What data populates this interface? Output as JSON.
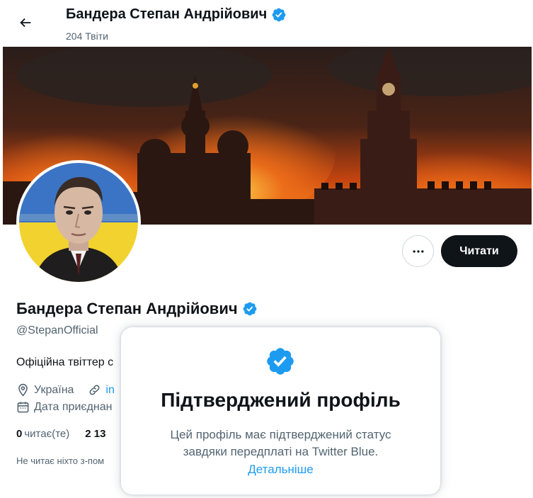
{
  "header": {
    "name": "Бандера Степан Андрійович",
    "tweets_count": "204 Твіти"
  },
  "profile": {
    "name": "Бандера Степан Андрійович",
    "handle": "@StepanOfficial",
    "bio": "Офіційна твіттер с",
    "location": "Україна",
    "link": "in",
    "joined": "Дата приєднан",
    "following_count": "0",
    "following_label": "читає(те)",
    "followers_count": "2 13",
    "followed_by_note": "Не читає ніхто з-пом"
  },
  "actions": {
    "more_label": "…",
    "follow_label": "Читати"
  },
  "verified_popover": {
    "title": "Підтверджений профіль",
    "description": "Цей профіль має підтверджений статус завдяки передплаті на Twitter Blue.",
    "link": "Детальніше"
  },
  "colors": {
    "accent": "#1d9bf0",
    "text": "#0f1419",
    "muted": "#536471",
    "follow_button": "#0f1419"
  },
  "icons": {
    "back": "arrow-left-icon",
    "verified": "verified-badge-icon",
    "more": "more-horizontal-icon",
    "location": "location-pin-icon",
    "link": "link-icon",
    "calendar": "calendar-icon"
  }
}
